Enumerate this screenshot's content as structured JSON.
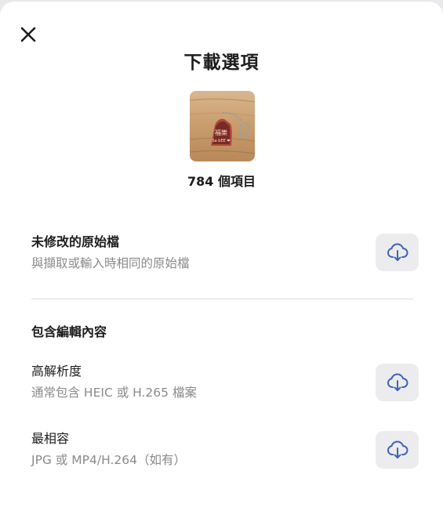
{
  "dialog": {
    "title": "下載選項",
    "item_count": "784 個項目"
  },
  "original": {
    "title": "未修改的原始檔",
    "description": "與擷取或輸入時相同的原始檔"
  },
  "edited_section": {
    "heading": "包含編輯內容",
    "options": [
      {
        "title": "高解析度",
        "description": "通常包含 HEIC 或 H.265 檔案"
      },
      {
        "title": "最相容",
        "description": "JPG 或 MP4/H.264（如有）"
      }
    ]
  },
  "thumbnail": {
    "tag_text_line1": "福樂",
    "tag_text_line2": "Sa bEE ❤"
  },
  "icons": {
    "close": "close-icon",
    "download": "cloud-download-icon"
  },
  "colors": {
    "accent": "#3e64b8",
    "button_bg": "#ececef",
    "secondary_text": "#8a8a8e"
  }
}
